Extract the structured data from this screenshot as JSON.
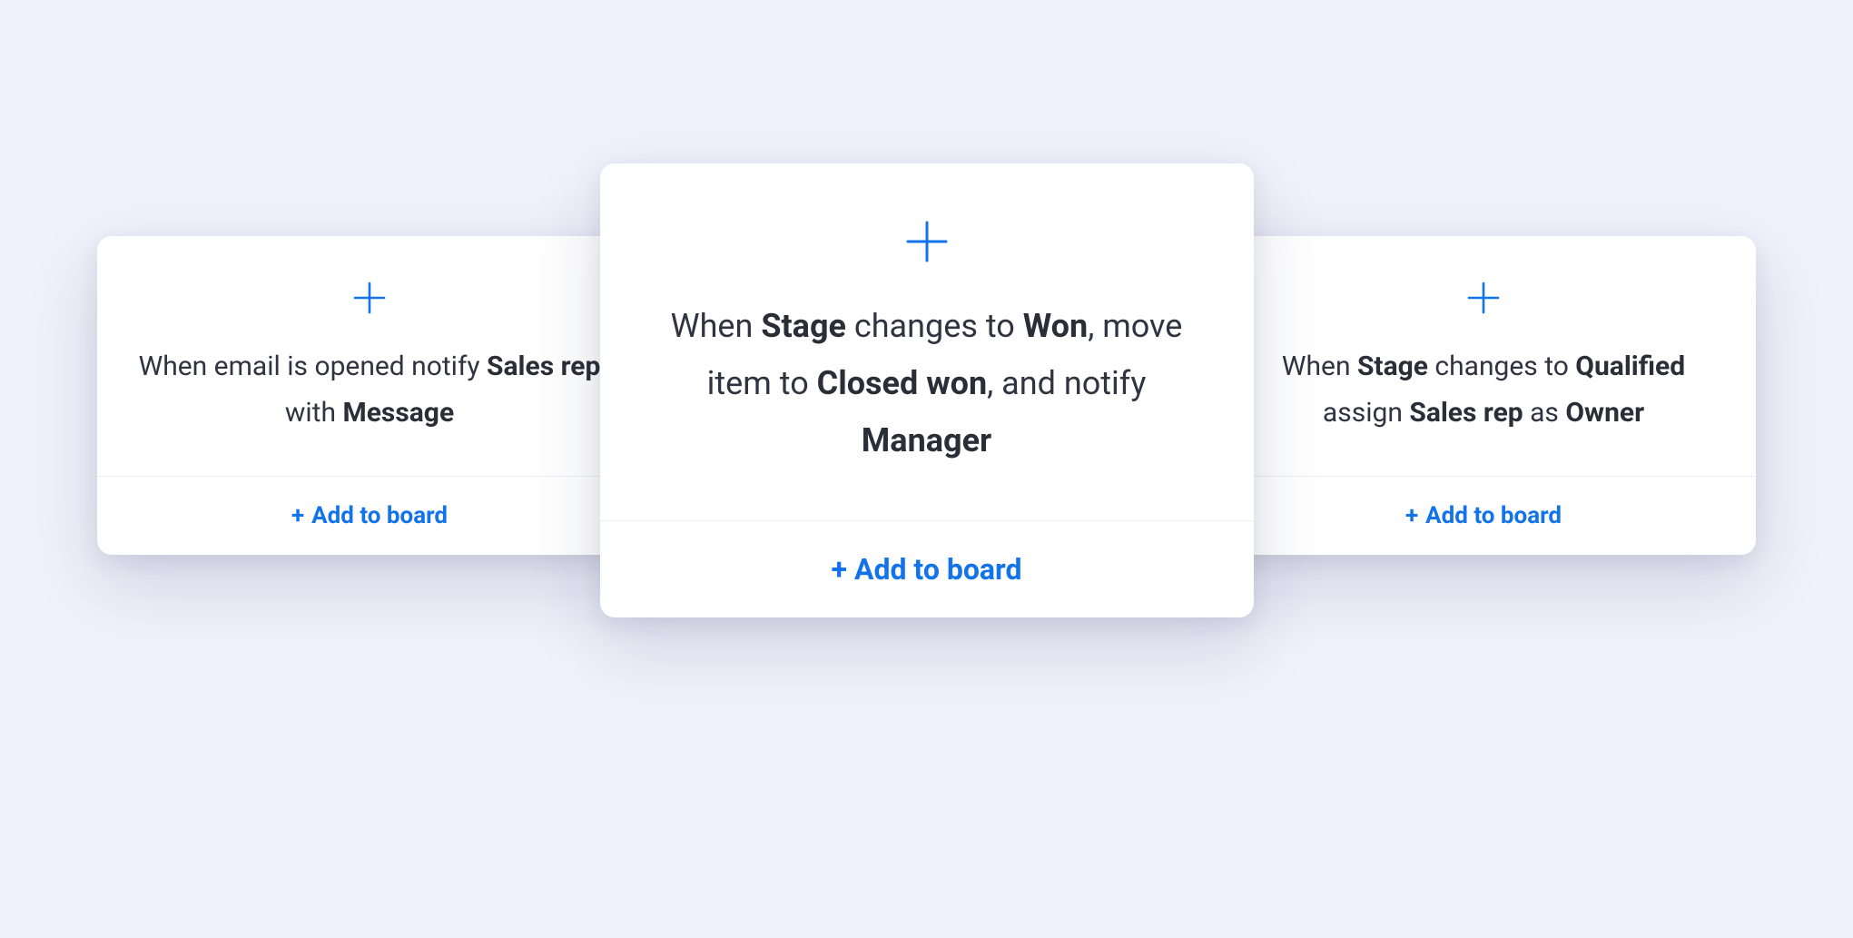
{
  "colors": {
    "accent": "#1273eb",
    "text": "#2f3440",
    "background": "#f0f1fb",
    "card": "#ffffff"
  },
  "cards": {
    "left": {
      "segments": [
        {
          "t": "When email is opened notify ",
          "b": false
        },
        {
          "t": "Sales rep",
          "b": true
        },
        {
          "t": " with ",
          "b": false
        },
        {
          "t": "Message",
          "b": true
        }
      ],
      "add_label": "Add to board"
    },
    "center": {
      "segments": [
        {
          "t": "When ",
          "b": false
        },
        {
          "t": "Stage",
          "b": true
        },
        {
          "t": " changes to ",
          "b": false
        },
        {
          "t": "Won",
          "b": true
        },
        {
          "t": ", move item to ",
          "b": false
        },
        {
          "t": "Closed won",
          "b": true
        },
        {
          "t": ", and notify ",
          "b": false
        },
        {
          "t": "Manager",
          "b": true
        }
      ],
      "add_label": "Add to board"
    },
    "right": {
      "segments": [
        {
          "t": "When ",
          "b": false
        },
        {
          "t": "Stage",
          "b": true
        },
        {
          "t": " changes to ",
          "b": false
        },
        {
          "t": "Qualified",
          "b": true
        },
        {
          "t": " assign ",
          "b": false
        },
        {
          "t": "Sales rep",
          "b": true
        },
        {
          "t": " as ",
          "b": false
        },
        {
          "t": "Owner",
          "b": true
        }
      ],
      "add_label": "Add to board"
    }
  }
}
